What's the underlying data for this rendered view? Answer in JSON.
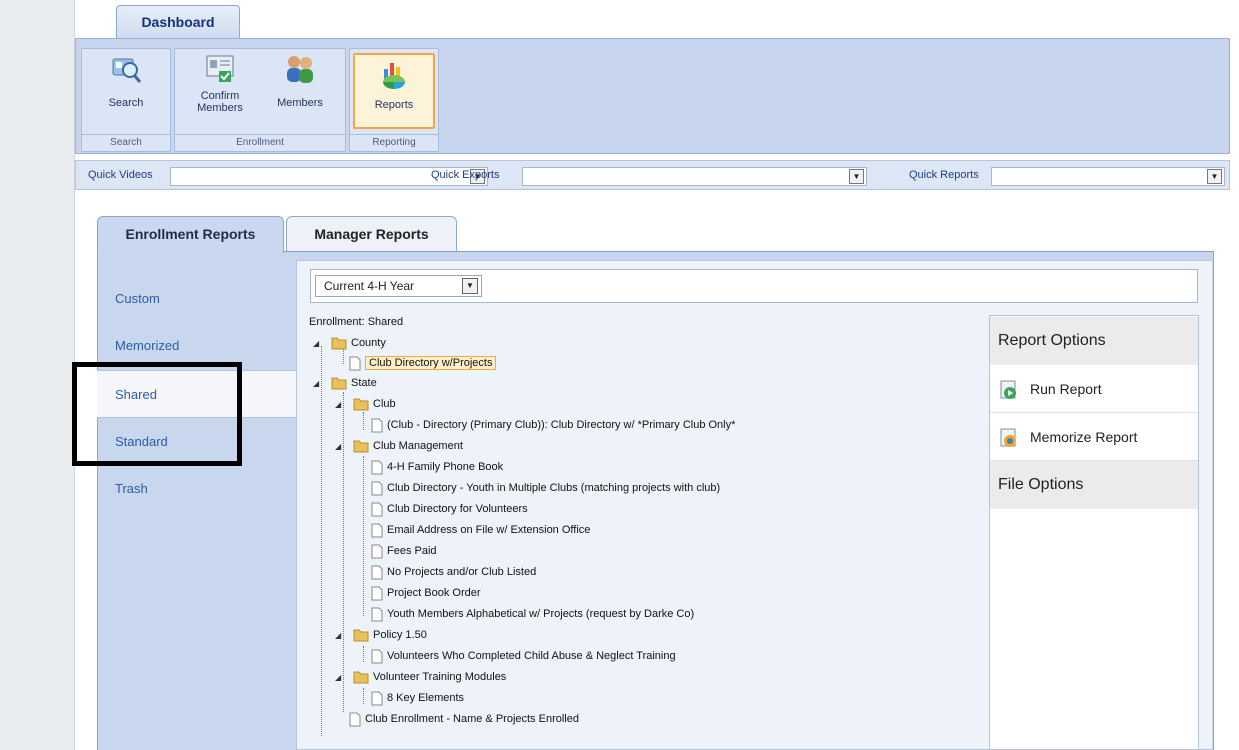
{
  "ribbon": {
    "tab_label": "Dashboard",
    "groups": [
      {
        "label": "Search",
        "buttons": [
          {
            "label": "Search",
            "icon": "search-icon"
          }
        ]
      },
      {
        "label": "Enrollment",
        "buttons": [
          {
            "label": "Confirm\nMembers",
            "icon": "confirm-members-icon"
          },
          {
            "label": "Members",
            "icon": "members-icon"
          }
        ]
      },
      {
        "label": "Reporting",
        "buttons": [
          {
            "label": "Reports",
            "icon": "reports-icon"
          }
        ]
      }
    ]
  },
  "quickbar": {
    "videos_label": "Quick Videos",
    "exports_label": "Quick Exports",
    "reports_label": "Quick Reports"
  },
  "tabs": {
    "enrollment": "Enrollment Reports",
    "manager": "Manager Reports"
  },
  "nav": {
    "items": [
      "Custom",
      "Memorized",
      "Shared",
      "Standard",
      "Trash"
    ],
    "selected": "Shared"
  },
  "year_select": {
    "value": "Current 4-H Year"
  },
  "tree": {
    "title": "Enrollment: Shared",
    "county": "County",
    "county_child": "Club Directory w/Projects",
    "state": "State",
    "club": "Club",
    "club_child": "(Club - Directory (Primary Club)): Club Directory w/ *Primary Club Only*",
    "club_mgmt": "Club Management",
    "club_mgmt_children": [
      "4-H Family Phone Book",
      "Club Directory - Youth in Multiple Clubs (matching projects with club)",
      "Club Directory for Volunteers",
      "Email Address on File w/ Extension Office",
      "Fees Paid",
      "No Projects and/or Club Listed",
      "Project Book Order",
      "Youth Members Alphabetical w/ Projects (request by Darke Co)"
    ],
    "policy": "Policy 1.50",
    "policy_child": "Volunteers Who Completed Child Abuse & Neglect Training",
    "vtm": "Volunteer Training Modules",
    "vtm_child": "8 Key Elements",
    "last": "Club Enrollment - Name & Projects Enrolled"
  },
  "options": {
    "report_header": "Report Options",
    "run": "Run Report",
    "memorize": "Memorize Report",
    "file_header": "File Options"
  }
}
